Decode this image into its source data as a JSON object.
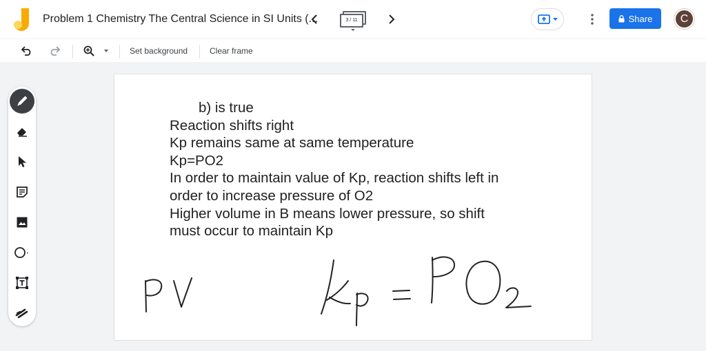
{
  "header": {
    "title": "Problem 1 Chemistry The Central Science in SI Units (...",
    "frame_counter": "3 / 11",
    "share_label": "Share",
    "avatar_initial": "C"
  },
  "toolbar": {
    "set_background_label": "Set background",
    "clear_frame_label": "Clear frame"
  },
  "side_tools": [
    {
      "name": "pen",
      "active": true
    },
    {
      "name": "eraser"
    },
    {
      "name": "select"
    },
    {
      "name": "sticky-note"
    },
    {
      "name": "image"
    },
    {
      "name": "circle"
    },
    {
      "name": "text-box"
    },
    {
      "name": "laser"
    }
  ],
  "canvas": {
    "lines": [
      "b) is true",
      "Reaction shifts right",
      "Kp remains same at same temperature",
      "Kp=PO2",
      "In order to maintain value of Kp, reaction shifts left in",
      "order to increase pressure of O2",
      "Higher volume in B means lower pressure, so shift",
      "must occur to maintain Kp"
    ]
  },
  "colors": {
    "accent": "#1a73e8",
    "active_tool": "#3c4043",
    "background": "#f1f3f4"
  }
}
